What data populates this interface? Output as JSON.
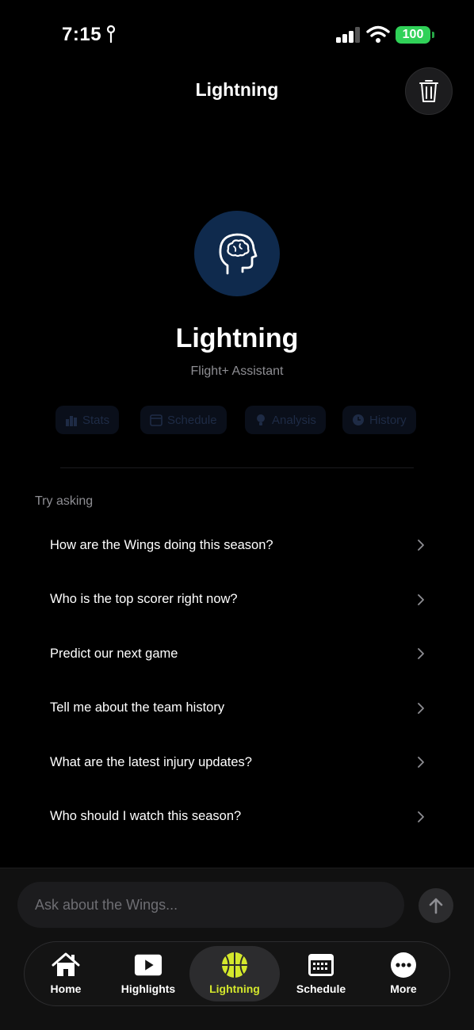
{
  "status_bar": {
    "time": "7:15",
    "battery": "100"
  },
  "header": {
    "title": "Lightning"
  },
  "assistant": {
    "name": "Lightning",
    "subtitle": "Flight+ Assistant"
  },
  "chips": [
    {
      "label": "Stats",
      "icon": "bar-chart-icon"
    },
    {
      "label": "Schedule",
      "icon": "calendar-icon"
    },
    {
      "label": "Analysis",
      "icon": "lightbulb-icon"
    },
    {
      "label": "History",
      "icon": "clock-icon"
    }
  ],
  "try_asking": {
    "label": "Try asking",
    "items": [
      "How are the Wings doing this season?",
      "Who is the top scorer right now?",
      "Predict our next game",
      "Tell me about the team history",
      "What are the latest injury updates?",
      "Who should I watch this season?"
    ]
  },
  "input": {
    "placeholder": "Ask about the Wings..."
  },
  "tabs": [
    {
      "label": "Home",
      "icon": "home-icon",
      "active": false
    },
    {
      "label": "Highlights",
      "icon": "play-icon",
      "active": false
    },
    {
      "label": "Lightning",
      "icon": "basketball-icon",
      "active": true
    },
    {
      "label": "Schedule",
      "icon": "calendar-icon",
      "active": false
    },
    {
      "label": "More",
      "icon": "more-icon",
      "active": false
    }
  ],
  "colors": {
    "accent": "#d4e82c",
    "battery": "#30d158",
    "avatar_bg": "#0f2a4d"
  }
}
